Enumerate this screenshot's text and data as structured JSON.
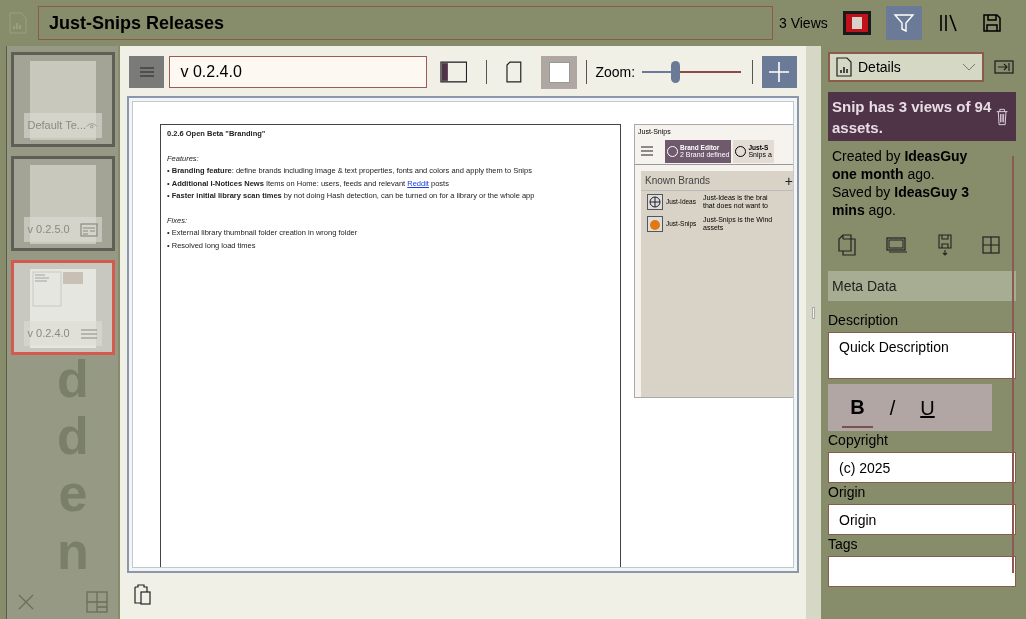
{
  "window": {
    "title": "Just-Snips Releases",
    "views": "3 Views"
  },
  "thumbnails": [
    {
      "label": "Default Te...",
      "selected": false
    },
    {
      "label": "v 0.2.5.0",
      "selected": false
    },
    {
      "label": "v 0.2.4.0",
      "selected": true
    }
  ],
  "sidebar_background_text": "dden",
  "toolbar": {
    "version": "v 0.2.4.0",
    "zoom_label": "Zoom:",
    "zoom": {
      "level": 0.33
    }
  },
  "document": {
    "heading": "0.2.6 Open Beta \"Branding\"",
    "features_label": "Features:",
    "features": [
      [
        {
          "kind": "plain",
          "text": "• "
        },
        {
          "kind": "bold",
          "text": "Branding feature"
        },
        {
          "kind": "plain",
          "text": ": define brands including image & text properties, fonts and colors and apply them to Snips"
        }
      ],
      [
        {
          "kind": "plain",
          "text": "• "
        },
        {
          "kind": "bold",
          "text": "Additional I-Notices News"
        },
        {
          "kind": "plain",
          "text": " Items on Home: users, feeds and relevant "
        },
        {
          "kind": "link",
          "text": "Reddit"
        },
        {
          "kind": "plain",
          "text": " posts"
        }
      ],
      [
        {
          "kind": "plain",
          "text": "• "
        },
        {
          "kind": "bold",
          "text": "Faster initial library scan times"
        },
        {
          "kind": "plain",
          "text": " by not doing Hash detection, can be turned on for a library or the whole app"
        }
      ]
    ],
    "fixes_label": "Fixes:",
    "fixes": [
      "• External library thumbnail folder creation in wrong folder",
      "• Resolved long load times"
    ]
  },
  "embedded_app": {
    "title": "Just-Snips",
    "tabs": [
      {
        "title": "Brand Editor",
        "subtitle": "2 Brand defined",
        "selected": true
      },
      {
        "title": "Just-S",
        "subtitle": "Snips a",
        "selected": false
      }
    ],
    "panel_title": "Known Brands",
    "add": "+",
    "brands": [
      {
        "name": "Just-Ideas",
        "description": [
          "Just-Ideas is the brai",
          "that does not want to"
        ]
      },
      {
        "name": "Just-Snips",
        "description": [
          "Just-Snips is the Wind",
          "assets"
        ]
      }
    ]
  },
  "details": {
    "dropdown": "Details",
    "summary": "Snip has **3** views of **94** assets.",
    "created": "Created by **IdeasGuy one month** ago.",
    "saved": "Saved by **IdeasGuy 3 mins** ago.",
    "meta_header": "Meta Data",
    "fields": [
      {
        "label": "Description",
        "value": "Quick Description",
        "kind": "multiline"
      },
      {
        "kind": "format",
        "buttons": [
          {
            "label": "B",
            "selected": true
          },
          {
            "label": "/",
            "selected": false
          },
          {
            "label": "U",
            "selected": false
          }
        ]
      },
      {
        "label": "Copyright",
        "value": "(c) 2025",
        "kind": "text"
      },
      {
        "label": "Origin",
        "value": "Origin",
        "kind": "text"
      },
      {
        "label": "Tags",
        "kind": "text"
      }
    ]
  }
}
